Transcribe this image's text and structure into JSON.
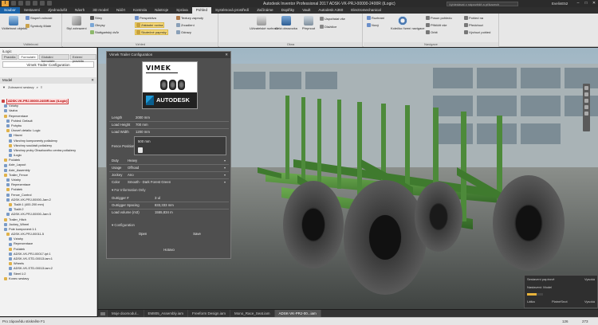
{
  "titlebar": {
    "logo": "I",
    "title": "Autodesk Inventor Professional 2017   ADSK-VK-PRJ-00000-2400R (iLogic)",
    "search_placeholder": "Vyhledávat v nápovědě a příkazech",
    "user": "EvelinE52"
  },
  "tabs": [
    "Soubor",
    "Sestavení",
    "Zjednodušit",
    "Návrh",
    "3D model",
    "Náčrt",
    "Kontrola",
    "Nástroje",
    "Správa",
    "Pohled",
    "Systémová prostředí",
    "Začínáme",
    "Doplňky",
    "Vault",
    "Autodesk A360",
    "Electromechanical"
  ],
  "ribbon": {
    "groups": [
      {
        "title": "Viditelnost",
        "buttons": [
          "Viditelnost objektu",
          "Stupeň volnosti",
          "Symboly iMate"
        ],
        "big": "Viditelnost objektu"
      },
      {
        "title": "Vzhled",
        "buttons": [
          "Styl zobrazení",
          "Stíny",
          "Obrysy",
          "Stuttgartský dvůr",
          "Perspektiva",
          "Základní rovina",
          "Skutečné paprsky",
          "Textury zapnuty",
          "Zrcadlení",
          "Odrazy"
        ]
      },
      {
        "title": "Okna",
        "buttons": [
          "Uživatelské rozhraní",
          "Celá obrazovka",
          "Přepnout",
          "Uspořádat vše",
          "Dlaždice"
        ]
      },
      {
        "title": "Navigace",
        "buttons": [
          "Kolečko řízení navigace",
          "Posun pohledu",
          "Přiblížit vše",
          "Orbit",
          "Pohled na",
          "Předchozí",
          "Výchozí pohled",
          "Rozhraní",
          "Nový"
        ]
      }
    ],
    "highlighted": "Základní rovina"
  },
  "leftpanel": {
    "header": "iLogic",
    "ilogic_tabs": [
      "Pravidla",
      "Formuláře",
      "Globální formuláře",
      "Externí pravidla"
    ],
    "active_ilogic_tab": "Formuláře",
    "form_item": "Vimek Trailer Configuration",
    "model_header": "Model",
    "model_tools": "Zobrazení sestavy",
    "tree": [
      {
        "label": "ADSK-VK-PRJ-00000-2400R.iam (iLogic)",
        "kind": "root"
      },
      {
        "label": "Vztahy",
        "kind": "n"
      },
      {
        "label": "Vazba",
        "kind": "n"
      },
      {
        "label": "Reprezentace",
        "kind": "n"
      },
      {
        "label": "Pohled: Default",
        "kind": "n"
      },
      {
        "label": "Pohybu",
        "kind": "n"
      },
      {
        "label": "Úroveň detailu: Logic",
        "kind": "n"
      },
      {
        "label": "Hlavní",
        "kind": "n"
      },
      {
        "label": "Všechny komponenty potlačeny",
        "kind": "n"
      },
      {
        "label": "Všechny součásti potlačeny",
        "kind": "n"
      },
      {
        "label": "Všechny prvky Obsahového centra potlačeny",
        "kind": "n"
      },
      {
        "label": "iLogic",
        "kind": "n"
      },
      {
        "label": "Počátek",
        "kind": "n"
      },
      {
        "label": "Axle_Layout",
        "kind": "n"
      },
      {
        "label": "Axle_Assembly",
        "kind": "n"
      },
      {
        "label": "Trailer_Fence",
        "kind": "n"
      },
      {
        "label": "Vztahy",
        "kind": "n"
      },
      {
        "label": "Reprezentace",
        "kind": "n"
      },
      {
        "label": "Počátek",
        "kind": "n"
      },
      {
        "label": "Fence_Control",
        "kind": "n"
      },
      {
        "label": "ADSK-VK-PRJ-00000-Jam:2",
        "kind": "n"
      },
      {
        "label": "Tlačit:1 (400-200 mm)",
        "kind": "n"
      },
      {
        "label": "Tlačit:2",
        "kind": "n"
      },
      {
        "label": "ADSK-VK-PRJ-00000-Jam:3",
        "kind": "n"
      },
      {
        "label": "Trailer_Hitch",
        "kind": "n"
      },
      {
        "label": "Jockey_Wheel",
        "kind": "n"
      },
      {
        "label": "Pole komponent:1:1",
        "kind": "n"
      },
      {
        "label": "ADSK-VK-PRJ-00011-5",
        "kind": "n"
      },
      {
        "label": "Vztahy",
        "kind": "n"
      },
      {
        "label": "Reprezentace",
        "kind": "n"
      },
      {
        "label": "Počátek",
        "kind": "n"
      },
      {
        "label": "ADSK-VK-PRJ-00017-ipt:1",
        "kind": "n"
      },
      {
        "label": "ADSK-VK-STD-00013.iam:1",
        "kind": "n"
      },
      {
        "label": "Wheels",
        "kind": "n"
      },
      {
        "label": "ADSK-VK-STD-00013.iam:2",
        "kind": "n"
      },
      {
        "label": "Steel:1:2",
        "kind": "n"
      },
      {
        "label": "Konec sestavy",
        "kind": "n"
      }
    ]
  },
  "dialog": {
    "title": "Vimek Trailer Configuration",
    "brand": "VIMEK",
    "autodesk": "AUTODESK",
    "rows": [
      {
        "label": "Length",
        "value": "2000 mm"
      },
      {
        "label": "Load Height",
        "value": "700 mm"
      },
      {
        "label": "Load Width",
        "value": "1200 mm"
      }
    ],
    "fence_label": "Fence Position",
    "fence_value": "500 mm",
    "dropdowns": [
      {
        "label": "Duty",
        "value": "Heavy"
      },
      {
        "label": "Usage",
        "value": "Offroad"
      },
      {
        "label": "Jockey",
        "value": "Ano"
      },
      {
        "label": "Color",
        "value": "Smooth - Dark Forest Green"
      }
    ],
    "info_section": "For Information Only",
    "info_rows": [
      {
        "label": "Outrigger #",
        "value": "3 ul"
      },
      {
        "label": "Outrigger Spacing",
        "value": "833,333 mm"
      },
      {
        "label": "Load volume (m3)",
        "value": "1555,834 m"
      }
    ],
    "config_section": "Configuration",
    "open_button": "Open",
    "save_button": "Save",
    "close_button": "Hotovo"
  },
  "minimap": {
    "title": "Sestavení papírově",
    "title_right": "Vysoká",
    "row2": "Nastavení: Model",
    "row3_left": "Látka",
    "row3_mid": "PlatnéSnot",
    "row3_right": "Vysoká",
    "progress": 0.6
  },
  "doctabs": [
    "Moje doomodul...",
    "EM805_Assembly.iam",
    "Freeform Design.iam",
    "Mono_Race_Seat.iam",
    "ADSK-VK-PRJ-00...iam"
  ],
  "active_doctab": "ADSK-VK-PRJ-00...iam",
  "statusbar": {
    "left": "Pro zápovědu stiskněte F1",
    "count1": "126",
    "count2": "273"
  },
  "colors": {
    "trailer_green": "#4d8a3a",
    "accent_blue": "#1a63a8",
    "root_red": "#b00000"
  }
}
